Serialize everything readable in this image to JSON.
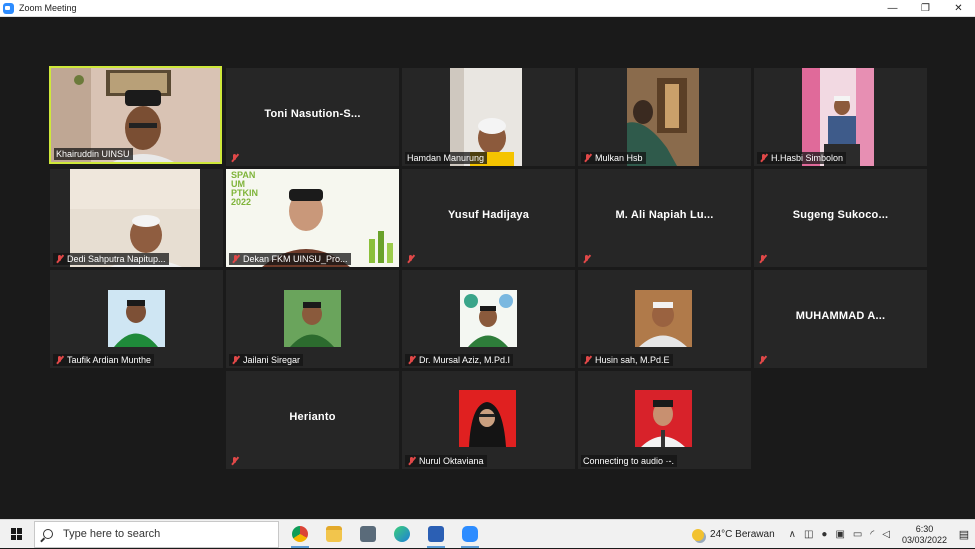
{
  "window": {
    "title": "Zoom Meeting",
    "controls": [
      "—",
      "❐",
      "✕"
    ]
  },
  "participants": [
    {
      "name": "Khairuddin UINSU",
      "display": "video",
      "muted": false,
      "active": true
    },
    {
      "name": "Toni  Nasution-S...",
      "display": "name",
      "muted": true
    },
    {
      "name": "Hamdan Manurung",
      "display": "video",
      "muted": false
    },
    {
      "name": "Mulkan Hsb",
      "display": "video",
      "muted": true
    },
    {
      "name": "H.Hasbi Simbolon",
      "display": "video",
      "muted": true
    },
    {
      "name": "Dedi Sahputra Napitup...",
      "display": "video",
      "muted": true
    },
    {
      "name": "Dekan FKM UINSU_Pro...",
      "display": "video",
      "muted": true
    },
    {
      "name": "Yusuf Hadijaya",
      "display": "name",
      "muted": true
    },
    {
      "name": "M. Ali Napiah Lu...",
      "display": "name",
      "muted": true
    },
    {
      "name": "Sugeng  Sukoco...",
      "display": "name",
      "muted": true
    },
    {
      "name": "Taufik Ardian Munthe",
      "display": "photo",
      "muted": true
    },
    {
      "name": "Jailani Siregar",
      "display": "photo",
      "muted": true
    },
    {
      "name": "Dr. Mursal Aziz, M.Pd.I",
      "display": "photo",
      "muted": true
    },
    {
      "name": "Husin sah, M.Pd.E",
      "display": "photo",
      "muted": true
    },
    {
      "name": "MUHAMMAD  A...",
      "display": "name",
      "muted": true
    },
    {
      "name": "Herianto",
      "display": "name",
      "muted": true
    },
    {
      "name": "Nurul Oktaviana",
      "display": "photo",
      "muted": true
    },
    {
      "name": "Connecting to audio ·-.",
      "display": "photo",
      "muted": false
    }
  ],
  "dekan_slide": {
    "line1": "SPAN",
    "line2": "UM",
    "line3": "PTKIN",
    "line4": "2022"
  },
  "taskbar": {
    "search_placeholder": "Type here to search",
    "weather_temp": "24°C",
    "weather_text": "Berawan",
    "time": "6:30",
    "date": "03/03/2022"
  },
  "colors": {
    "active_border": "#cfe83a",
    "tile_bg": "#262626",
    "muted_red": "#e04848"
  }
}
